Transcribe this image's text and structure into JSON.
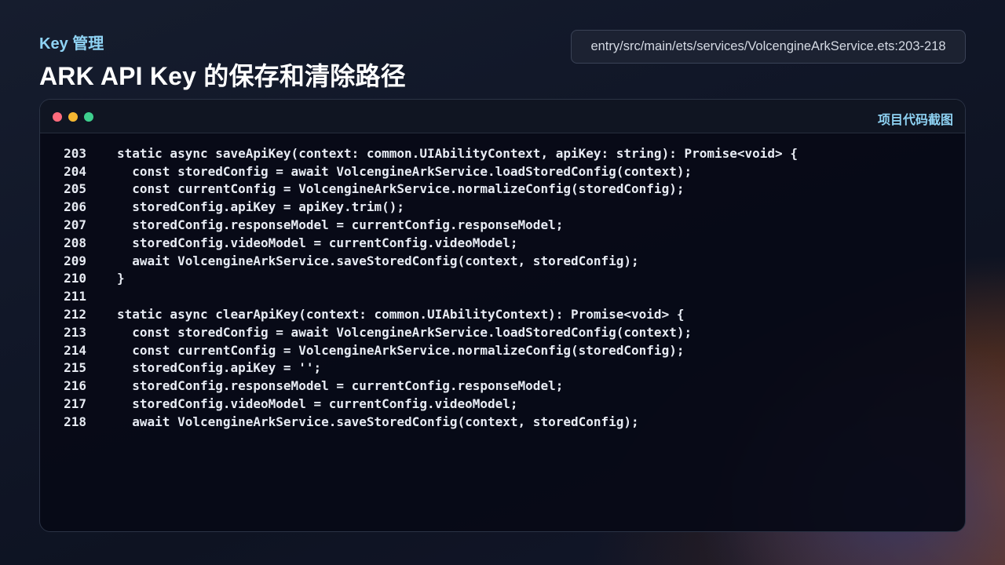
{
  "header": {
    "kicker": "Key 管理",
    "title": "ARK API Key 的保存和清除路径",
    "file_path": "entry/src/main/ets/services/VolcengineArkService.ets:203-218"
  },
  "window": {
    "label": "项目代码截图",
    "traffic_lights": [
      "#ff6b7d",
      "#f5b731",
      "#3ecf8e"
    ]
  },
  "code": {
    "lines": [
      {
        "num": "203",
        "text": "static async saveApiKey(context: common.UIAbilityContext, apiKey: string): Promise<void> {"
      },
      {
        "num": "204",
        "text": "  const storedConfig = await VolcengineArkService.loadStoredConfig(context);"
      },
      {
        "num": "205",
        "text": "  const currentConfig = VolcengineArkService.normalizeConfig(storedConfig);"
      },
      {
        "num": "206",
        "text": "  storedConfig.apiKey = apiKey.trim();"
      },
      {
        "num": "207",
        "text": "  storedConfig.responseModel = currentConfig.responseModel;"
      },
      {
        "num": "208",
        "text": "  storedConfig.videoModel = currentConfig.videoModel;"
      },
      {
        "num": "209",
        "text": "  await VolcengineArkService.saveStoredConfig(context, storedConfig);"
      },
      {
        "num": "210",
        "text": "}"
      },
      {
        "num": "211",
        "text": ""
      },
      {
        "num": "212",
        "text": "static async clearApiKey(context: common.UIAbilityContext): Promise<void> {"
      },
      {
        "num": "213",
        "text": "  const storedConfig = await VolcengineArkService.loadStoredConfig(context);"
      },
      {
        "num": "214",
        "text": "  const currentConfig = VolcengineArkService.normalizeConfig(storedConfig);"
      },
      {
        "num": "215",
        "text": "  storedConfig.apiKey = '';"
      },
      {
        "num": "216",
        "text": "  storedConfig.responseModel = currentConfig.responseModel;"
      },
      {
        "num": "217",
        "text": "  storedConfig.videoModel = currentConfig.videoModel;"
      },
      {
        "num": "218",
        "text": "  await VolcengineArkService.saveStoredConfig(context, storedConfig);"
      }
    ]
  }
}
